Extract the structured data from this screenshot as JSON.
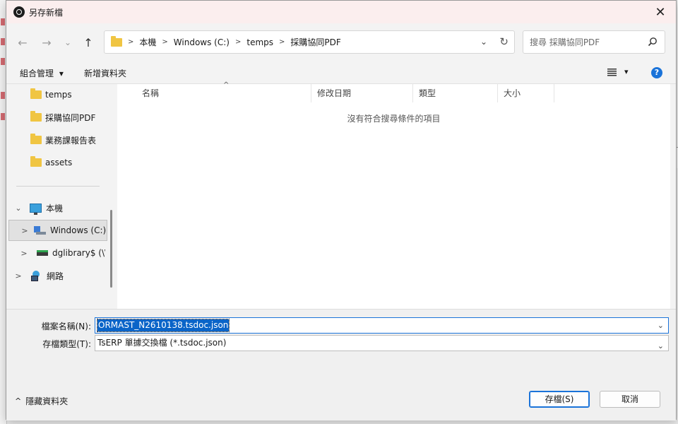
{
  "dialog": {
    "title": "另存新檔",
    "close_label": "✕"
  },
  "navbar": {
    "back_glyph": "←",
    "forward_glyph": "→",
    "recent_glyph": "⌄",
    "up_glyph": "↑",
    "breadcrumbs": [
      "本機",
      "Windows (C:)",
      "temps",
      "採購協同PDF"
    ],
    "search_placeholder": "搜尋 採購協同PDF"
  },
  "commands": {
    "organize": "組合管理",
    "organize_arrow": "▾",
    "new_folder": "新增資料夾",
    "view_arrow": "▾",
    "help": "?"
  },
  "nav_pane": {
    "quick_items": [
      "temps",
      "採購協同PDF",
      "業務課報告表",
      "assets"
    ],
    "this_pc": "本機",
    "drive_c": "Windows (C:)",
    "net_drive": "dglibrary$ (\\\\",
    "network": "網路"
  },
  "file_list": {
    "columns": [
      "名稱",
      "修改日期",
      "類型",
      "大小"
    ],
    "empty_message": "沒有符合搜尋條件的項目"
  },
  "form": {
    "filename_label": "檔案名稱(N):",
    "filename_value": "ORMAST_N2610138.tsdoc.json",
    "filetype_label": "存檔類型(T):",
    "filetype_value": "TsERP 單據交換檔 (*.tsdoc.json)"
  },
  "footer": {
    "hide_folders": "隱藏資料夾",
    "save": "存檔(S)",
    "cancel": "取消"
  },
  "colors": {
    "accent": "#1a73d9",
    "folder": "#f0c542",
    "title_bar": "#fbeeee"
  }
}
